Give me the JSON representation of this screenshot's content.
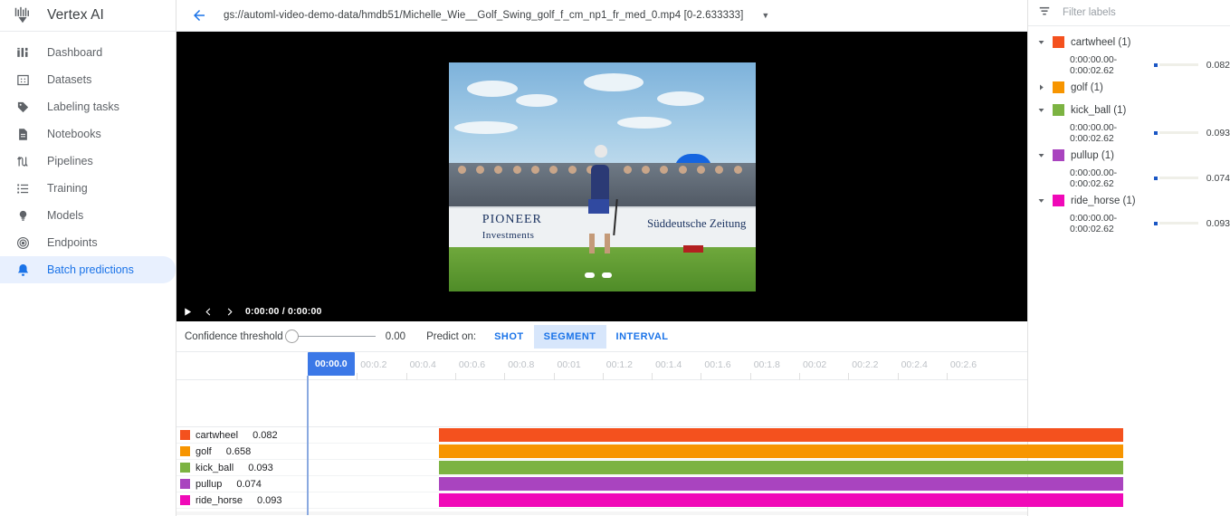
{
  "brand": {
    "title": "Vertex AI",
    "logo_icon": "vertex-ai-logo"
  },
  "sidebar": {
    "items": [
      {
        "label": "Dashboard",
        "icon": "dashboard-icon",
        "active": false
      },
      {
        "label": "Datasets",
        "icon": "datasets-icon",
        "active": false
      },
      {
        "label": "Labeling tasks",
        "icon": "tag-icon",
        "active": false
      },
      {
        "label": "Notebooks",
        "icon": "notebook-icon",
        "active": false
      },
      {
        "label": "Pipelines",
        "icon": "pipelines-icon",
        "active": false
      },
      {
        "label": "Training",
        "icon": "list-icon",
        "active": false
      },
      {
        "label": "Models",
        "icon": "lightbulb-icon",
        "active": false
      },
      {
        "label": "Endpoints",
        "icon": "target-icon",
        "active": false
      },
      {
        "label": "Batch predictions",
        "icon": "bell-icon",
        "active": true
      }
    ]
  },
  "topbar": {
    "back_icon": "back-arrow-icon",
    "path": "gs://automl-video-demo-data/hmdb51/Michelle_Wie__Golf_Swing_golf_f_cm_np1_fr_med_0.mp4 [0-2.633333]",
    "caret": "▼"
  },
  "player": {
    "play_icon": "play-icon",
    "prev_icon": "previous-frame-icon",
    "next_icon": "next-frame-icon",
    "time_display": "0:00:00 / 0:00:00",
    "video_overlay": {
      "banner_line1": "PIONEER",
      "banner_line2": "Investments",
      "banner_line3": "Süddeutsche Zeitung"
    }
  },
  "controls": {
    "confidence_label": "Confidence threshold",
    "confidence_value": "0.00",
    "predict_on_label": "Predict on:",
    "modes": [
      {
        "label": "SHOT",
        "active": false
      },
      {
        "label": "SEGMENT",
        "active": true
      },
      {
        "label": "INTERVAL",
        "active": false
      }
    ]
  },
  "timeline": {
    "playhead_label": "00:00.0",
    "ticks": [
      "00:00.0",
      "00:0.2",
      "00:0.4",
      "00:0.6",
      "00:0.8",
      "00:01",
      "00:1.2",
      "00:1.4",
      "00:1.6",
      "00:1.8",
      "00:02",
      "00:2.2",
      "00:2.4",
      "00:2.6"
    ],
    "rows": [
      {
        "label": "cartwheel",
        "score": "0.082",
        "color": "#f4511e"
      },
      {
        "label": "golf",
        "score": "0.658",
        "color": "#f79500"
      },
      {
        "label": "kick_ball",
        "score": "0.093",
        "color": "#7cb342"
      },
      {
        "label": "pullup",
        "score": "0.074",
        "color": "#a944bf"
      },
      {
        "label": "ride_horse",
        "score": "0.093",
        "color": "#f009b8"
      }
    ]
  },
  "rightpanel": {
    "filter_icon": "filter-icon",
    "filter_placeholder": "Filter labels",
    "labels": [
      {
        "name": "cartwheel (1)",
        "color": "#f4511e",
        "expanded": true,
        "segments": [
          {
            "time": "0:00:00.00-0:00:02.62",
            "score": "0.082"
          }
        ]
      },
      {
        "name": "golf (1)",
        "color": "#f79500",
        "expanded": false,
        "segments": []
      },
      {
        "name": "kick_ball (1)",
        "color": "#7cb342",
        "expanded": true,
        "segments": [
          {
            "time": "0:00:00.00-0:00:02.62",
            "score": "0.093"
          }
        ]
      },
      {
        "name": "pullup (1)",
        "color": "#a944bf",
        "expanded": true,
        "segments": [
          {
            "time": "0:00:00.00-0:00:02.62",
            "score": "0.074"
          }
        ]
      },
      {
        "name": "ride_horse (1)",
        "color": "#f009b8",
        "expanded": true,
        "segments": [
          {
            "time": "0:00:00.00-0:00:02.62",
            "score": "0.093"
          }
        ]
      }
    ]
  },
  "colors": {
    "accent": "#1a73e8",
    "playhead": "#3b78e7",
    "active_nav_bg": "#e8f0fe"
  }
}
